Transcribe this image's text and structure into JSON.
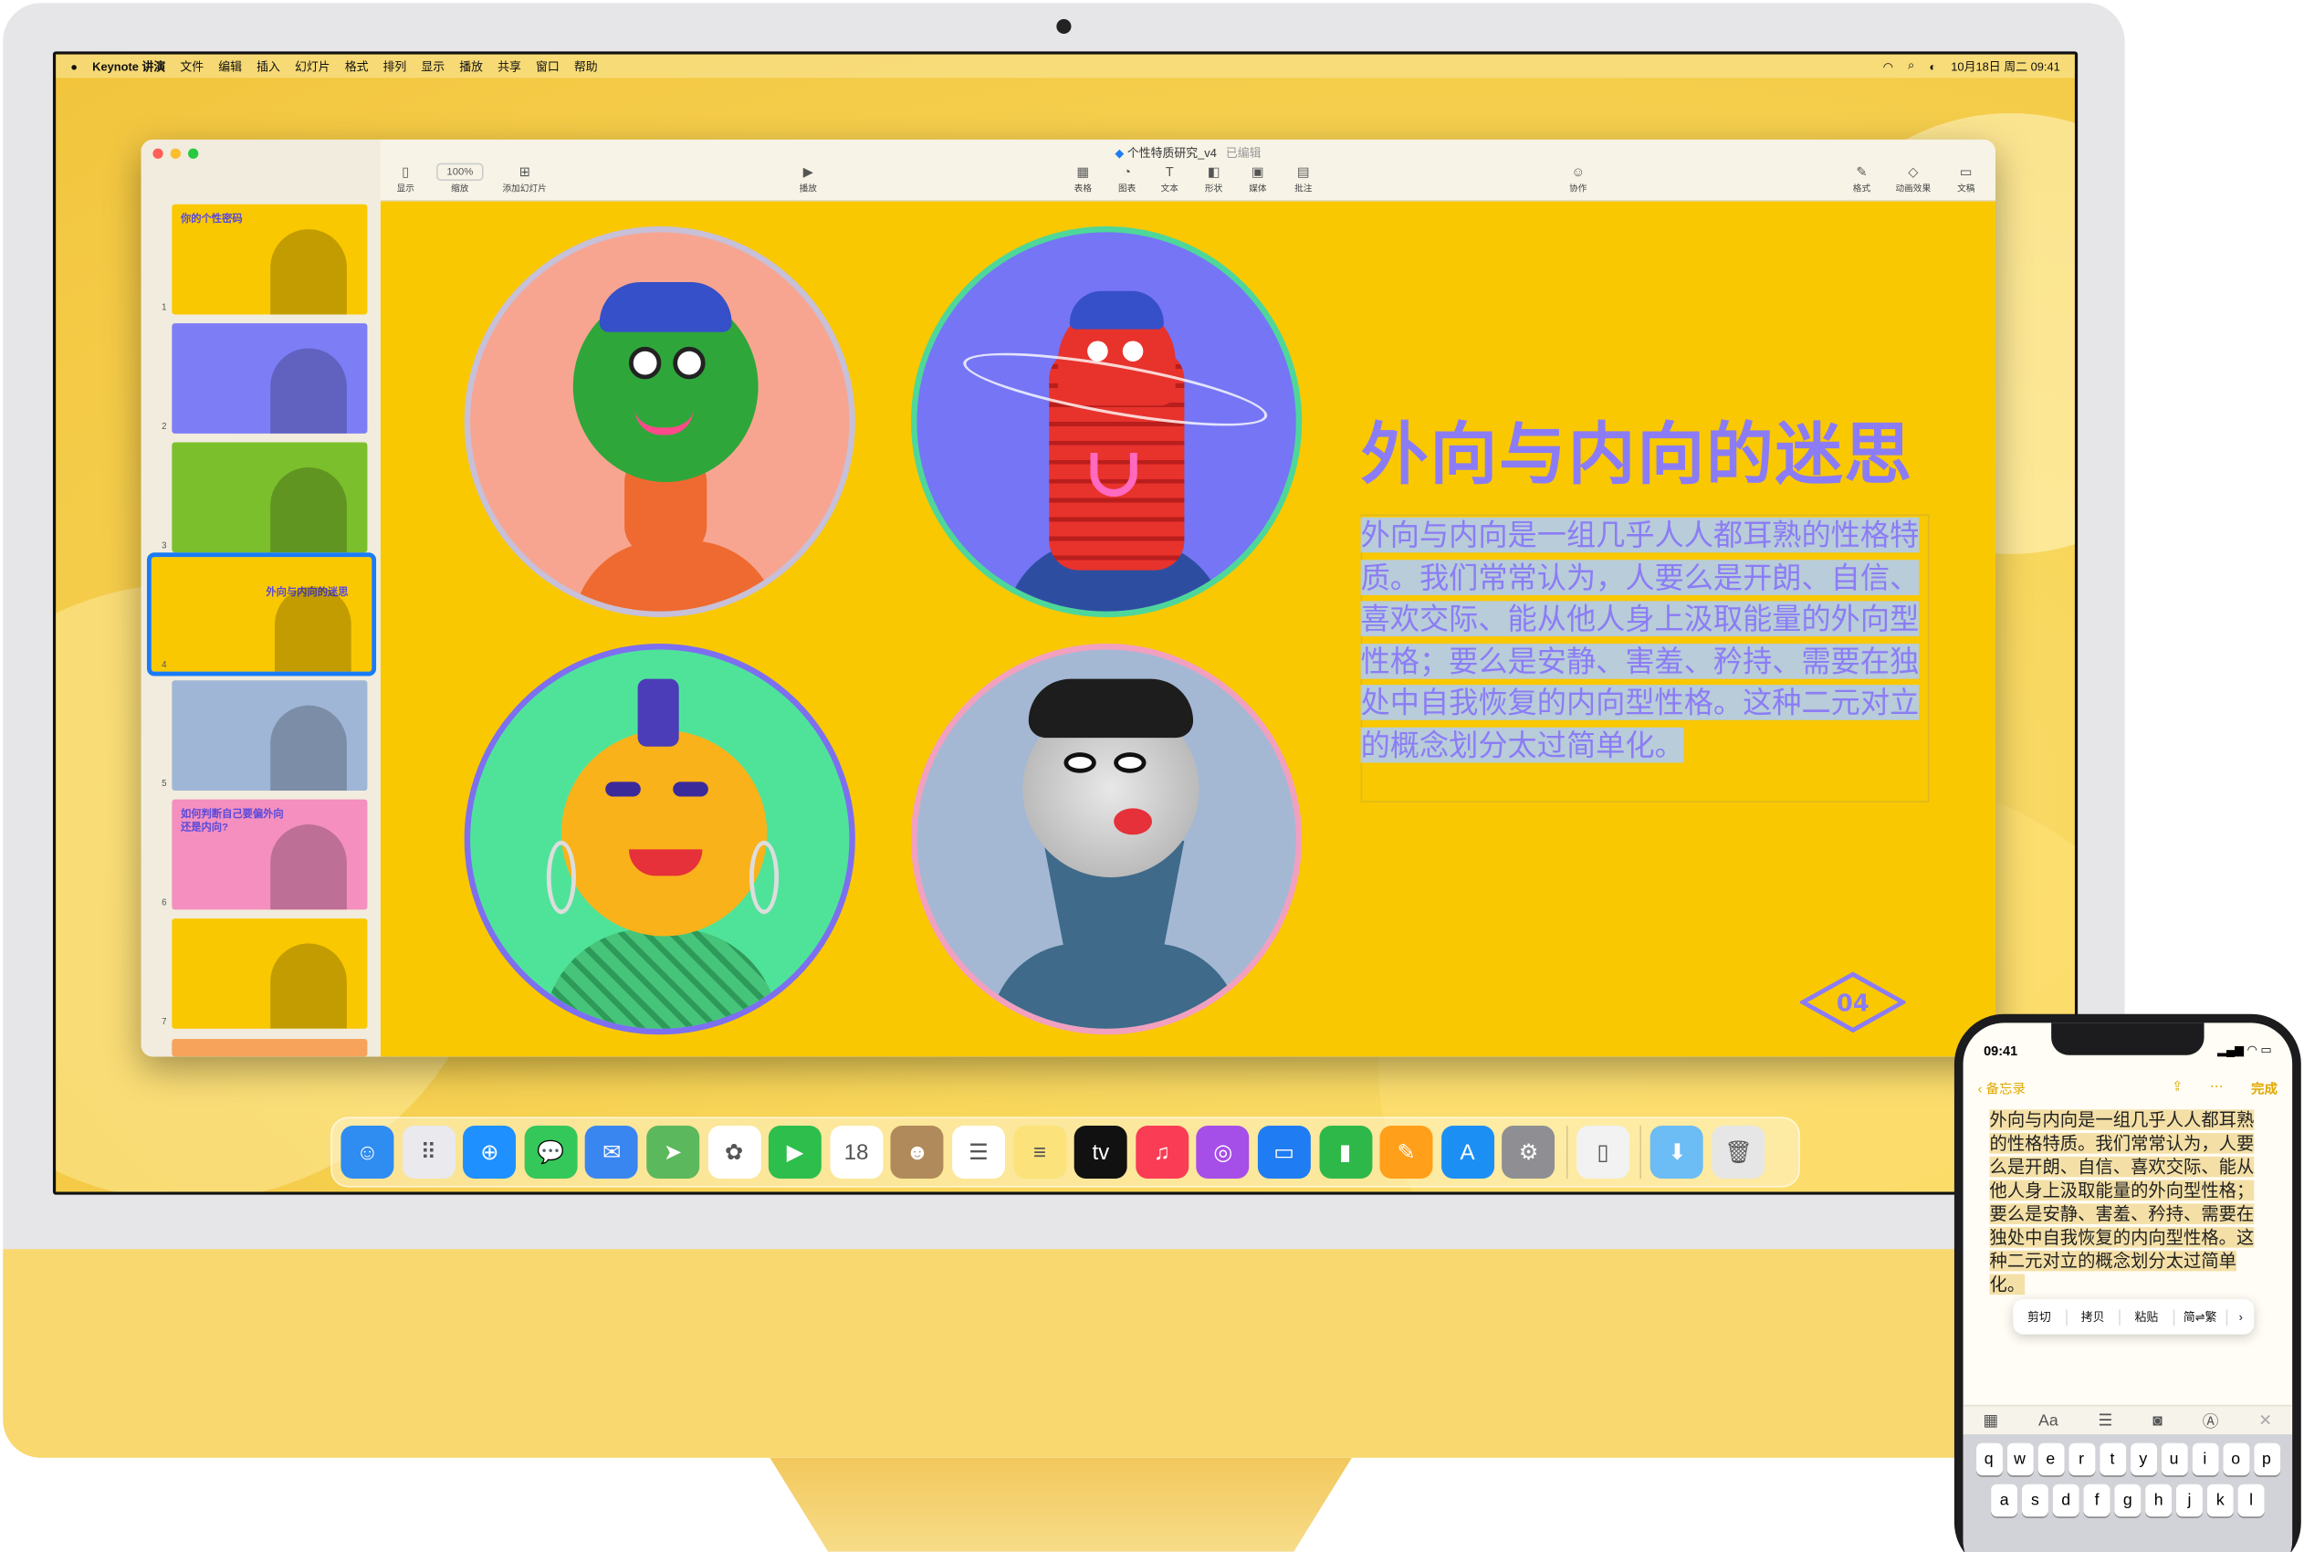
{
  "menubar": {
    "app": "Keynote 讲演",
    "items": [
      "文件",
      "编辑",
      "插入",
      "幻灯片",
      "格式",
      "排列",
      "显示",
      "播放",
      "共享",
      "窗口",
      "帮助"
    ],
    "datetime": "10月18日 周二 09:41"
  },
  "window": {
    "doc_title": "个性特质研究_v4",
    "doc_status": "已编辑",
    "toolbar": {
      "view": "显示",
      "zoom_value": "100%",
      "zoom": "缩放",
      "add_slide": "添加幻灯片",
      "play": "播放",
      "table": "表格",
      "chart": "图表",
      "text": "文本",
      "shape": "形状",
      "media": "媒体",
      "comment": "批注",
      "collaborate": "协作",
      "format": "格式",
      "animate": "动画效果",
      "document": "文稿"
    },
    "thumbnails": [
      {
        "num": "1",
        "bg": "#f9c800",
        "title": "你的个性密码"
      },
      {
        "num": "2",
        "bg": "#7d7df6",
        "title": ""
      },
      {
        "num": "3",
        "bg": "#7bbf2c",
        "title": ""
      },
      {
        "num": "4",
        "bg": "#f9c800",
        "title": "外向与内向的迷思"
      },
      {
        "num": "5",
        "bg": "#9fb6d6",
        "title": ""
      },
      {
        "num": "6",
        "bg": "#f48fc0",
        "title": "如何判断自己要偏外向还是内向?"
      },
      {
        "num": "7",
        "bg": "#f9c800",
        "title": ""
      }
    ]
  },
  "slide": {
    "title": "外向与内向的迷思",
    "body": "外向与内向是一组几乎人人都耳熟的性格特质。我们常常认为，人要么是开朗、自信、喜欢交际、能从他人身上汲取能量的外向型性格；要么是安静、害羞、矜持、需要在独处中自我恢复的内向型性格。这种二元对立的概念划分太过简单化。",
    "number": "04"
  },
  "dock": {
    "apps": [
      {
        "name": "finder-icon",
        "color": "#2f8cf0",
        "glyph": "☺"
      },
      {
        "name": "launchpad-icon",
        "color": "#e9e9ee",
        "glyph": "⠿"
      },
      {
        "name": "safari-icon",
        "color": "#1e90ff",
        "glyph": "⊕"
      },
      {
        "name": "messages-icon",
        "color": "#34c759",
        "glyph": "💬"
      },
      {
        "name": "mail-icon",
        "color": "#3a86f0",
        "glyph": "✉"
      },
      {
        "name": "maps-icon",
        "color": "#5cb85c",
        "glyph": "➤"
      },
      {
        "name": "photos-icon",
        "color": "#ffffff",
        "glyph": "✿"
      },
      {
        "name": "facetime-icon",
        "color": "#2dbe4c",
        "glyph": "▶"
      },
      {
        "name": "calendar-icon",
        "color": "#ffffff",
        "glyph": "18"
      },
      {
        "name": "contacts-icon",
        "color": "#b08a5a",
        "glyph": "☻"
      },
      {
        "name": "reminders-icon",
        "color": "#ffffff",
        "glyph": "☰"
      },
      {
        "name": "notes-icon",
        "color": "#fbe27a",
        "glyph": "≡"
      },
      {
        "name": "appletv-icon",
        "color": "#111111",
        "glyph": "tv"
      },
      {
        "name": "music-icon",
        "color": "#fa3c54",
        "glyph": "♫"
      },
      {
        "name": "podcasts-icon",
        "color": "#a64ee8",
        "glyph": "◎"
      },
      {
        "name": "keynote-icon",
        "color": "#1f7cf2",
        "glyph": "▭"
      },
      {
        "name": "numbers-icon",
        "color": "#2fb84a",
        "glyph": "▮"
      },
      {
        "name": "pages-icon",
        "color": "#ff9f1a",
        "glyph": "✎"
      },
      {
        "name": "appstore-icon",
        "color": "#1c8ff5",
        "glyph": "A"
      },
      {
        "name": "system-settings-icon",
        "color": "#8e8e93",
        "glyph": "⚙"
      },
      {
        "name": "iphone-mirroring-icon",
        "color": "#f2f2f2",
        "glyph": "▯"
      },
      {
        "name": "downloads-folder-icon",
        "color": "#6cbcf5",
        "glyph": "⬇"
      },
      {
        "name": "trash-icon",
        "color": "#e6e6e6",
        "glyph": "🗑"
      }
    ]
  },
  "phone": {
    "time": "09:41",
    "back_label": "备忘录",
    "done_label": "完成",
    "note_text": "外向与内向是一组几乎人人都耳熟的性格特质。我们常常认为，人要么是开朗、自信、喜欢交际、能从他人身上汲取能量的外向型性格；要么是安静、害羞、矜持、需要在独处中自我恢复的内向型性格。这种二元对立的概念划分太过简单化。",
    "edit_menu": [
      "剪切",
      "拷贝",
      "粘贴",
      "简⇌繁",
      "›"
    ],
    "keyboard_row1": [
      "q",
      "w",
      "e",
      "r",
      "t",
      "y",
      "u",
      "i",
      "o",
      "p"
    ],
    "keyboard_row2": [
      "a",
      "s",
      "d",
      "f",
      "g",
      "h",
      "j",
      "k",
      "l"
    ]
  }
}
